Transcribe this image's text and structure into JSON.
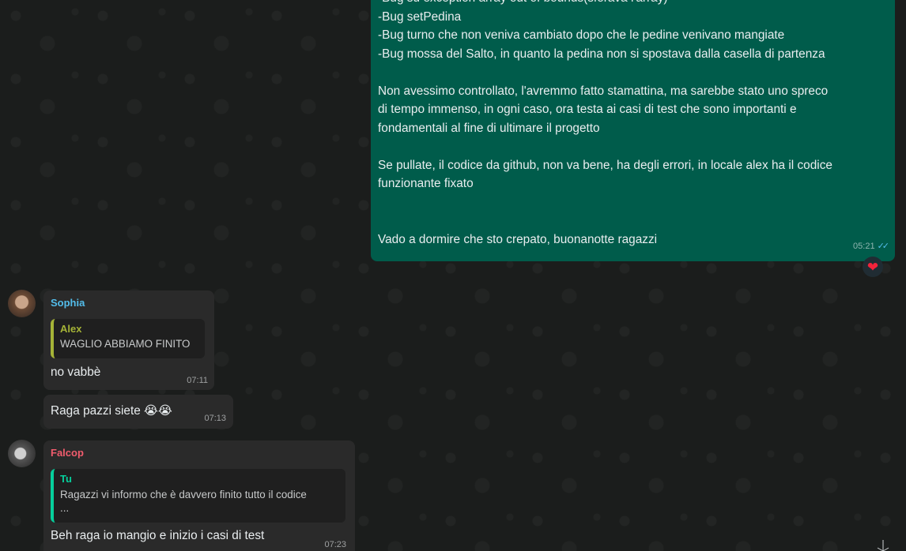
{
  "outgoing": {
    "lines": [
      "-Bug su exception array out of bounds(sforava l'array)",
      "-Bug setPedina",
      "-Bug turno che non veniva cambiato dopo che le pedine venivano mangiate",
      "-Bug mossa del Salto, in quanto la pedina non si spostava dalla casella di partenza",
      "",
      "Non avessimo controllato, l'avremmo fatto stamattina, ma sarebbe stato uno spreco",
      "di tempo immenso, in ogni caso, ora testa ai casi di test che sono importanti e",
      "fondamentali al fine di ultimare il progetto",
      "",
      "Se pullate, il codice da github, non va bene, ha degli errori, in locale alex ha il codice",
      "funzionante fixato",
      "",
      "",
      "Vado a dormire che sto crepato, buonanotte ragazzi"
    ],
    "time": "05:21",
    "ticks": "✓✓",
    "reaction": "❤"
  },
  "sophia": {
    "name": "Sophia",
    "name_color": "#53bdeb",
    "quote_author": "Alex",
    "quote_color": "#a5b337",
    "quote_text": "WAGLIO ABBIAMO FINITO",
    "message": "no vabbè",
    "time": "07:11"
  },
  "sophia2": {
    "message": "Raga pazzi siete 😭😭",
    "time": "07:13"
  },
  "falcop": {
    "name": "Falcop",
    "name_color": "#f15c6d",
    "quote_author": "Tu",
    "quote_color": "#06cf9c",
    "quote_text_1": "Ragazzi vi informo che è davvero finito tutto il codice",
    "quote_text_2": "...",
    "message": "Beh raga io mangio e inizio i casi di test",
    "time": "07:23"
  }
}
